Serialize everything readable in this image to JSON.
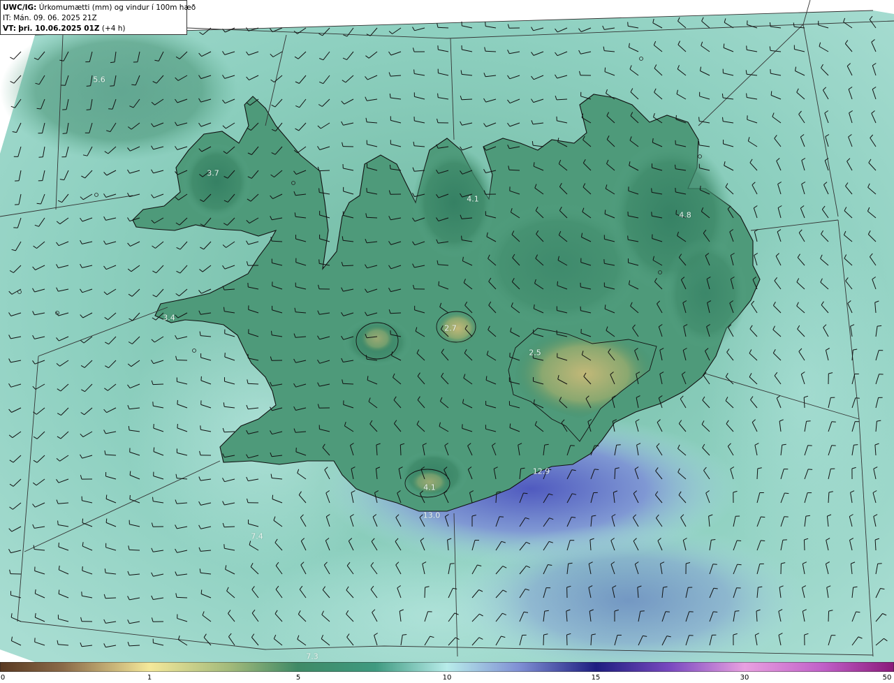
{
  "header": {
    "model": "UWC/IG:",
    "title": "Úrkomumætti (mm) og vindur í 100m hæð",
    "it_line": "IT: Mán. 09. 06. 2025 21Z",
    "vt_prefix": "VT:",
    "vt_bold": "þri. 10.06.2025 01Z",
    "vt_suffix": "(+4 h)"
  },
  "map_labels": [
    "5.6",
    "3.7",
    "4.1",
    "4.8",
    "3.4",
    "2.7",
    "2.5",
    "4.1",
    "12.9",
    "13.0",
    "7.4",
    "7.3"
  ],
  "colorbar": {
    "ticks": [
      "0",
      "1",
      "5",
      "10",
      "15",
      "30",
      "50"
    ],
    "colors": [
      "#5a3a22",
      "#b59a6a",
      "#f4e89a",
      "#9fb87a",
      "#3f8a66",
      "#2f7a62",
      "#5fb8a6",
      "#b8ecea",
      "#8090d4",
      "#2a2a8a",
      "#5a2ab0",
      "#e8a0e0",
      "#c060c8",
      "#8a1a7a"
    ]
  }
}
